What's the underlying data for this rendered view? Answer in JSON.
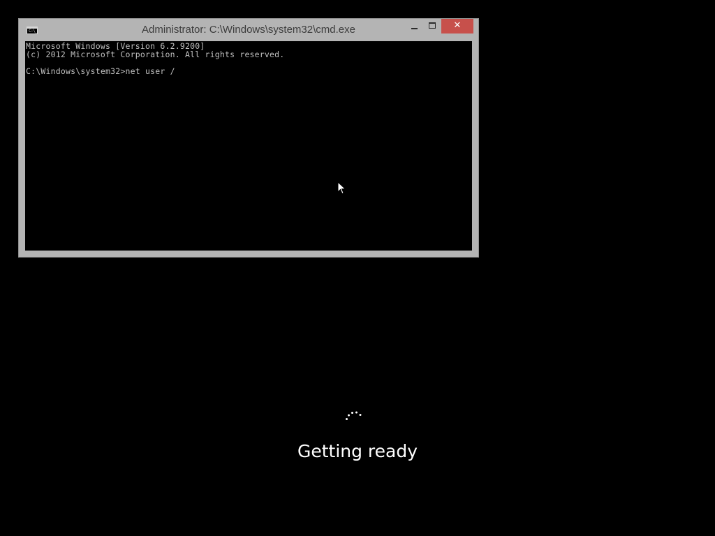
{
  "window": {
    "title": "Administrator: C:\\Windows\\system32\\cmd.exe",
    "icon": "cmd-icon",
    "icon_text": "C:\\_",
    "buttons": {
      "minimize": "minimize-icon",
      "maximize": "maximize-icon",
      "close_label": "✕"
    },
    "close_color": "#c7504b",
    "frame_color": "#b4b4b4"
  },
  "console": {
    "lines": [
      "Microsoft Windows [Version 6.2.9200]",
      "(c) 2012 Microsoft Corporation. All rights reserved.",
      "",
      "C:\\Windows\\system32>net user /"
    ],
    "text_color": "#c0c0c0",
    "background": "#000000"
  },
  "boot_screen": {
    "status_text": "Getting ready",
    "spinner": "loading-spinner-icon"
  },
  "pointer": "mouse-cursor-icon"
}
